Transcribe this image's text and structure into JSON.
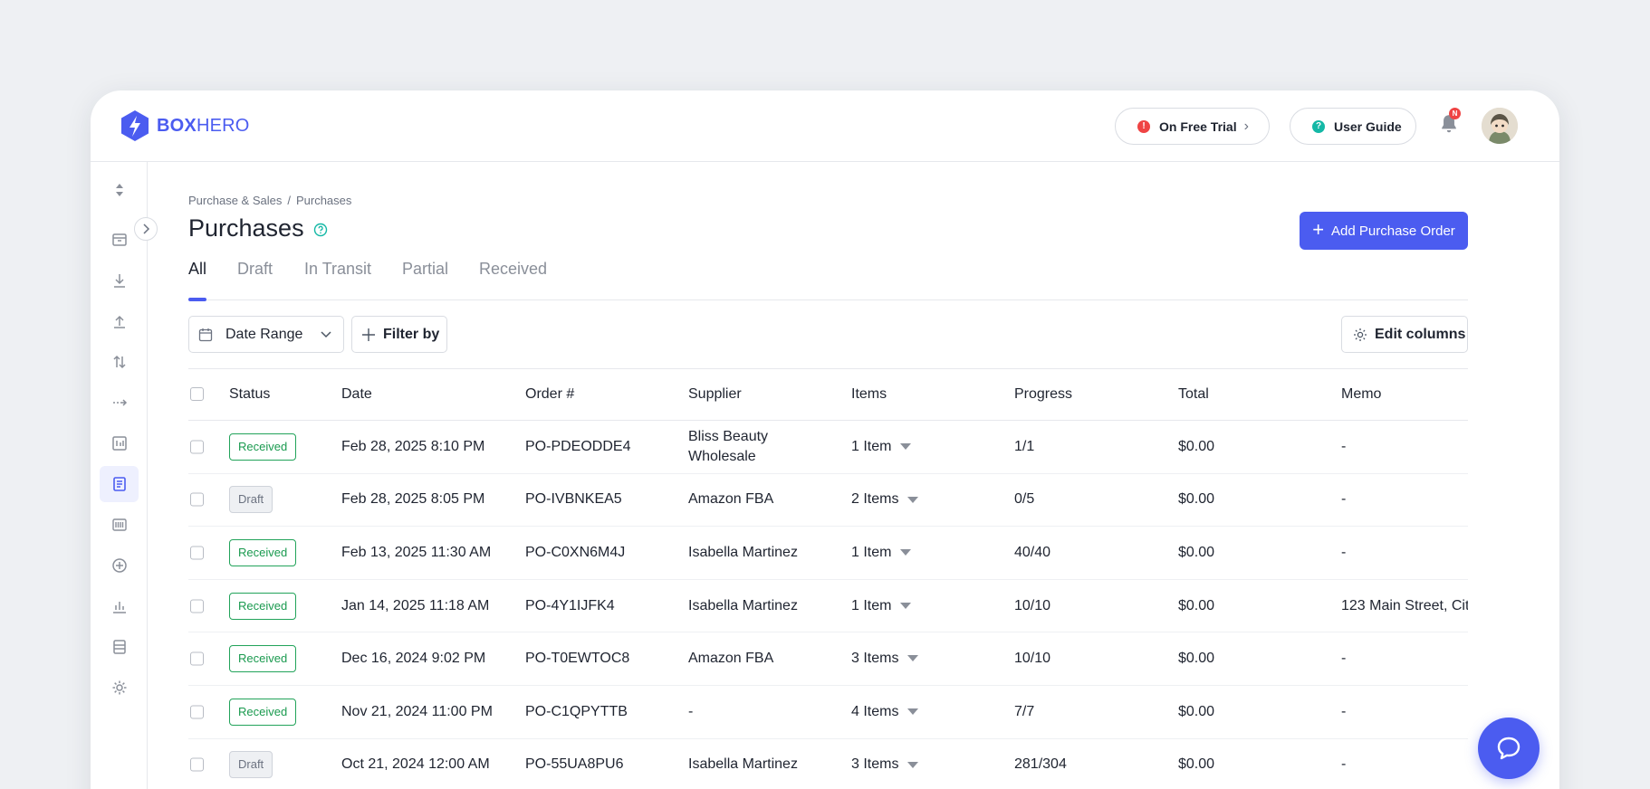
{
  "brand": {
    "bold": "BOX",
    "light": "HERO"
  },
  "header": {
    "trial_label": "On Free Trial",
    "guide_label": "User Guide",
    "notification_badge": "N"
  },
  "breadcrumb": {
    "parent": "Purchase & Sales",
    "separator": "/",
    "current": "Purchases"
  },
  "page": {
    "title": "Purchases",
    "add_button": "Add Purchase Order"
  },
  "tabs": [
    "All",
    "Draft",
    "In Transit",
    "Partial",
    "Received"
  ],
  "active_tab": "All",
  "toolbar": {
    "date_range": "Date Range",
    "filter": "Filter by",
    "edit_columns": "Edit columns"
  },
  "table": {
    "headers": [
      "Status",
      "Date",
      "Order #",
      "Supplier",
      "Items",
      "Progress",
      "Total",
      "Memo"
    ],
    "rows": [
      {
        "status": "Received",
        "date": "Feb 28, 2025 8:10 PM",
        "order": "PO-PDEODDE4",
        "supplier": "Bliss Beauty Wholesale",
        "items": "1 Item",
        "progress": "1/1",
        "total": "$0.00",
        "memo": "-"
      },
      {
        "status": "Draft",
        "date": "Feb 28, 2025 8:05 PM",
        "order": "PO-IVBNKEA5",
        "supplier": "Amazon FBA",
        "items": "2 Items",
        "progress": "0/5",
        "total": "$0.00",
        "memo": "-"
      },
      {
        "status": "Received",
        "date": "Feb 13, 2025 11:30 AM",
        "order": "PO-C0XN6M4J",
        "supplier": "Isabella Martinez",
        "items": "1 Item",
        "progress": "40/40",
        "total": "$0.00",
        "memo": "-"
      },
      {
        "status": "Received",
        "date": "Jan 14, 2025 11:18 AM",
        "order": "PO-4Y1IJFK4",
        "supplier": "Isabella Martinez",
        "items": "1 Item",
        "progress": "10/10",
        "total": "$0.00",
        "memo": "123 Main Street, Cit"
      },
      {
        "status": "Received",
        "date": "Dec 16, 2024 9:02 PM",
        "order": "PO-T0EWTOC8",
        "supplier": "Amazon FBA",
        "items": "3 Items",
        "progress": "10/10",
        "total": "$0.00",
        "memo": "-"
      },
      {
        "status": "Received",
        "date": "Nov 21, 2024 11:00 PM",
        "order": "PO-C1QPYTTB",
        "supplier": "-",
        "items": "4 Items",
        "progress": "7/7",
        "total": "$0.00",
        "memo": "-"
      },
      {
        "status": "Draft",
        "date": "Oct 21, 2024 12:00 AM",
        "order": "PO-55UA8PU6",
        "supplier": "Isabella Martinez",
        "items": "3 Items",
        "progress": "281/304",
        "total": "$0.00",
        "memo": "-"
      }
    ]
  },
  "colors": {
    "accent": "#4b5cf0",
    "received": "#1a9a4f",
    "alert": "#ef4444",
    "help": "#14b8a6"
  },
  "icons": {
    "rail": [
      "sort-icon",
      "box-icon",
      "download-icon",
      "upload-icon",
      "transfer-icon",
      "move-icon",
      "adjust-icon",
      "purchase-icon",
      "barcode-icon",
      "add-circle-icon",
      "chart-icon",
      "list-icon",
      "settings-icon"
    ]
  }
}
